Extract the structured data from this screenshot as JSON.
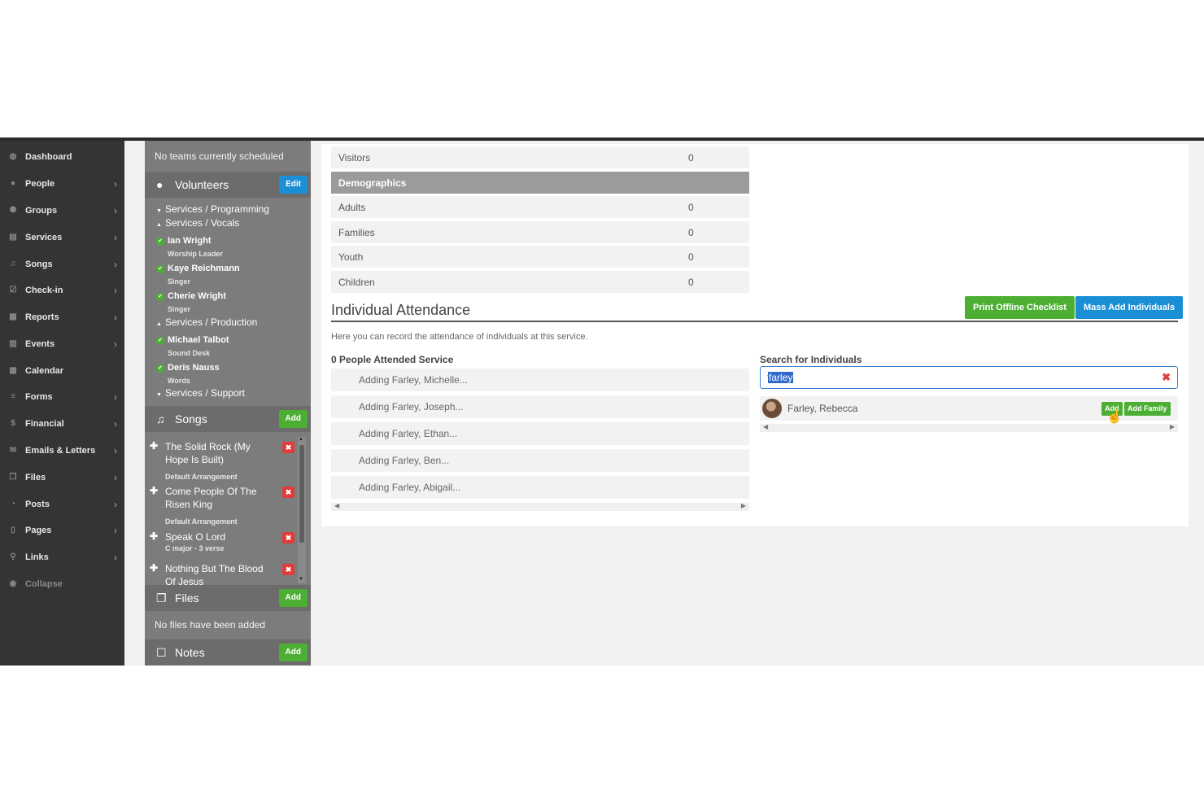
{
  "nav": {
    "items": [
      {
        "label": "Dashboard",
        "icon": "dashboard-icon",
        "glyph": "◍",
        "chevron": false
      },
      {
        "label": "People",
        "icon": "person-icon",
        "glyph": "●",
        "chevron": true
      },
      {
        "label": "Groups",
        "icon": "groups-icon",
        "glyph": "⚉",
        "chevron": true
      },
      {
        "label": "Services",
        "icon": "calendar-icon",
        "glyph": "▤",
        "chevron": true
      },
      {
        "label": "Songs",
        "icon": "music-icon",
        "glyph": "♫",
        "chevron": true
      },
      {
        "label": "Check-in",
        "icon": "checkbox-icon",
        "glyph": "☑",
        "chevron": true
      },
      {
        "label": "Reports",
        "icon": "report-icon",
        "glyph": "▦",
        "chevron": true
      },
      {
        "label": "Events",
        "icon": "events-icon",
        "glyph": "▥",
        "chevron": true
      },
      {
        "label": "Calendar",
        "icon": "calendar-icon",
        "glyph": "▦",
        "chevron": false
      },
      {
        "label": "Forms",
        "icon": "list-icon",
        "glyph": "≡",
        "chevron": true
      },
      {
        "label": "Financial",
        "icon": "dollar-icon",
        "glyph": "$",
        "chevron": true
      },
      {
        "label": "Emails & Letters",
        "icon": "envelope-icon",
        "glyph": "✉",
        "chevron": true
      },
      {
        "label": "Files",
        "icon": "files-icon",
        "glyph": "❐",
        "chevron": true
      },
      {
        "label": "Posts",
        "icon": "rss-icon",
        "glyph": "◔",
        "chevron": true
      },
      {
        "label": "Pages",
        "icon": "page-icon",
        "glyph": "▯",
        "chevron": true
      },
      {
        "label": "Links",
        "icon": "link-icon",
        "glyph": "⚲",
        "chevron": true
      },
      {
        "label": "Collapse",
        "icon": "collapse-icon",
        "glyph": "◉",
        "chevron": false
      }
    ]
  },
  "sidebar": {
    "teams_note": "No teams currently scheduled",
    "volunteers": {
      "title": "Volunteers",
      "edit_label": "Edit",
      "groups": [
        {
          "label": "Services / Programming",
          "caret": "▼"
        },
        {
          "label": "Services / Vocals",
          "caret": "▲"
        },
        {
          "label": "Services / Production",
          "caret": "▲"
        },
        {
          "label": "Services / Support",
          "caret": "▼"
        }
      ],
      "people": [
        {
          "name": "Ian Wright",
          "role": "Worship Leader"
        },
        {
          "name": "Kaye Reichmann",
          "role": "Singer"
        },
        {
          "name": "Cherie Wright",
          "role": "Singer"
        },
        {
          "name": "Michael Talbot",
          "role": "Sound Desk"
        },
        {
          "name": "Deris Nauss",
          "role": "Words"
        }
      ]
    },
    "songs": {
      "title": "Songs",
      "add_label": "Add",
      "items": [
        {
          "title": "The Solid Rock (My Hope Is Built)",
          "arrangement": "Default Arrangement"
        },
        {
          "title": "Come People Of The Risen King",
          "arrangement": "Default Arrangement"
        },
        {
          "title": "Speak O Lord",
          "arrangement": "C major - 3 verse"
        },
        {
          "title": "Nothing But The Blood Of Jesus",
          "arrangement": ""
        }
      ]
    },
    "files": {
      "title": "Files",
      "add_label": "Add",
      "empty_note": "No files have been added"
    },
    "notes": {
      "title": "Notes",
      "add_label": "Add"
    }
  },
  "stats": {
    "visitors": {
      "label": "Visitors",
      "value": "0"
    },
    "demographics_label": "Demographics",
    "rows": [
      {
        "label": "Adults",
        "value": "0"
      },
      {
        "label": "Families",
        "value": "0"
      },
      {
        "label": "Youth",
        "value": "0"
      },
      {
        "label": "Children",
        "value": "0"
      }
    ]
  },
  "individual_attendance": {
    "title": "Individual Attendance",
    "print_label": "Print Offline Checklist",
    "mass_add_label": "Mass Add Individuals",
    "description": "Here you can record the attendance of individuals at this service.",
    "attended_heading": "0 People Attended Service",
    "adding": [
      "Adding Farley, Michelle...",
      "Adding Farley, Joseph...",
      "Adding Farley, Ethan...",
      "Adding Farley, Ben...",
      "Adding Farley, Abigail..."
    ],
    "search": {
      "heading": "Search for Individuals",
      "value": "farley",
      "result_name": "Farley, Rebecca",
      "add_label": "Add",
      "add_family_label": "Add Family"
    }
  },
  "colors": {
    "sidebar_dark": "#343434",
    "panel_grey": "#7c7c7c",
    "accent_blue": "#1a8fd6",
    "accent_green": "#4caf33",
    "danger_red": "#e03c3c"
  }
}
